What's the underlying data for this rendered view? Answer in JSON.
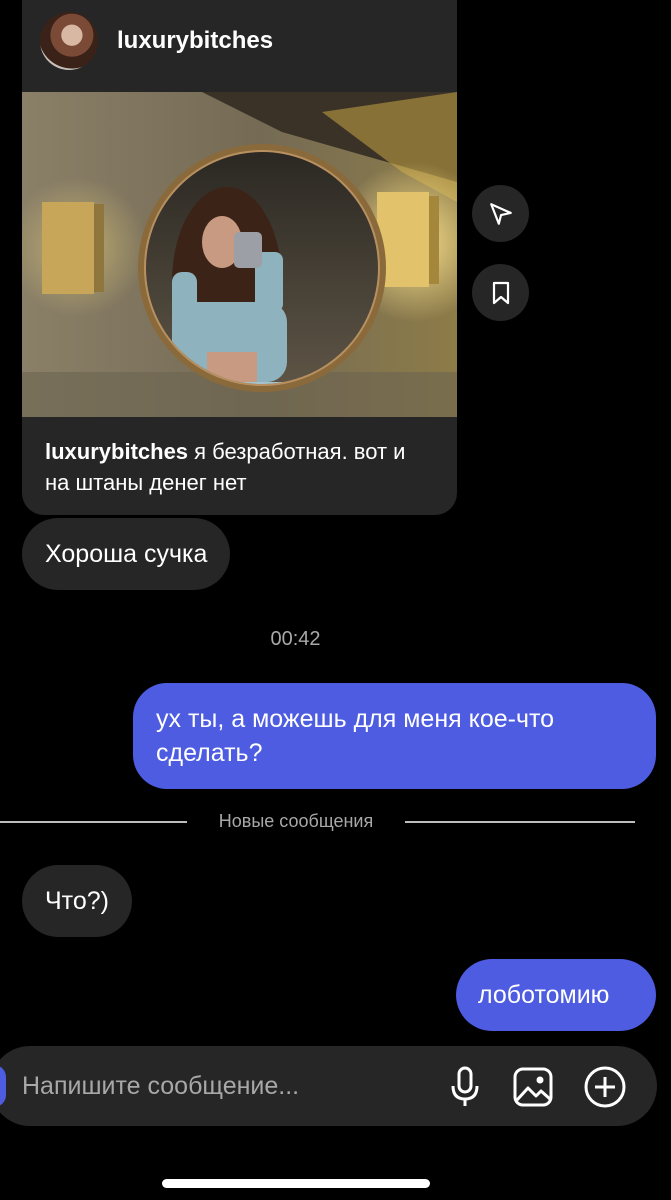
{
  "shared_post": {
    "username": "luxurybitches",
    "caption_user": "luxurybitches",
    "caption_text": " я безработная. вот и на штаны денег нет"
  },
  "side_actions": {
    "share_icon": "paper-plane-icon",
    "save_icon": "bookmark-icon"
  },
  "messages": [
    {
      "direction": "incoming",
      "text": "Хороша сучка"
    },
    {
      "direction": "outgoing",
      "text": "ух ты, а можешь для меня кое-что сделать?"
    },
    {
      "direction": "incoming",
      "text": "Что?)"
    },
    {
      "direction": "outgoing",
      "text": "лоботомию"
    }
  ],
  "timestamp": "00:42",
  "new_messages_divider": "Новые сообщения",
  "composer": {
    "placeholder": "Напишите сообщение...",
    "icons": [
      "microphone-icon",
      "image-icon",
      "plus-circle-icon"
    ]
  },
  "colors": {
    "background": "#000000",
    "incoming_bubble": "#262626",
    "outgoing_bubble": "#4d5ce0",
    "secondary_text": "#a8a8a8"
  }
}
